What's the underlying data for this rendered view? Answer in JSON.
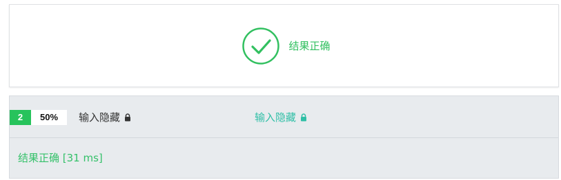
{
  "summary": {
    "status_text": "结果正确",
    "icon": "check-circle-icon",
    "accent_color": "#32c060"
  },
  "test_case": {
    "index": "2",
    "score": "50%",
    "input_label": "输入隐藏",
    "output_label": "输入隐藏",
    "lock_icon": "lock-icon",
    "result_text": "结果正确 [31 ms]",
    "index_color": "#27c35c",
    "output_color": "#2fbfa6"
  }
}
